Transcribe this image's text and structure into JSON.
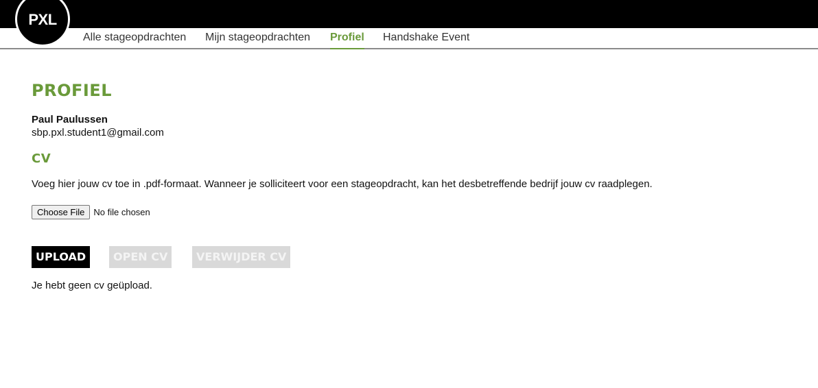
{
  "logo": {
    "text": "PXL"
  },
  "nav": {
    "items": [
      {
        "label": "Alle stageopdrachten",
        "active": false
      },
      {
        "label": "Mijn stageopdrachten",
        "active": false
      },
      {
        "label": "Profiel",
        "active": true
      },
      {
        "label": "Handshake Event",
        "active": false
      }
    ]
  },
  "profile": {
    "title": "PROFIEL",
    "name": "Paul Paulussen",
    "email": "sbp.pxl.student1@gmail.com"
  },
  "cv": {
    "title": "CV",
    "description": "Voeg hier jouw cv toe in .pdf-formaat. Wanneer je solliciteert voor een stageopdracht, kan het desbetreffende bedrijf jouw cv raadplegen.",
    "file_button": "Choose File",
    "file_status": "No file chosen",
    "upload_label": "UPLOAD",
    "open_label": "OPEN CV",
    "delete_label": "VERWIJDER CV",
    "status_message": "Je hebt geen cv geüpload."
  },
  "colors": {
    "accent": "#6a9a3a",
    "topbar": "#000000",
    "disabled": "#d9d9d9"
  }
}
